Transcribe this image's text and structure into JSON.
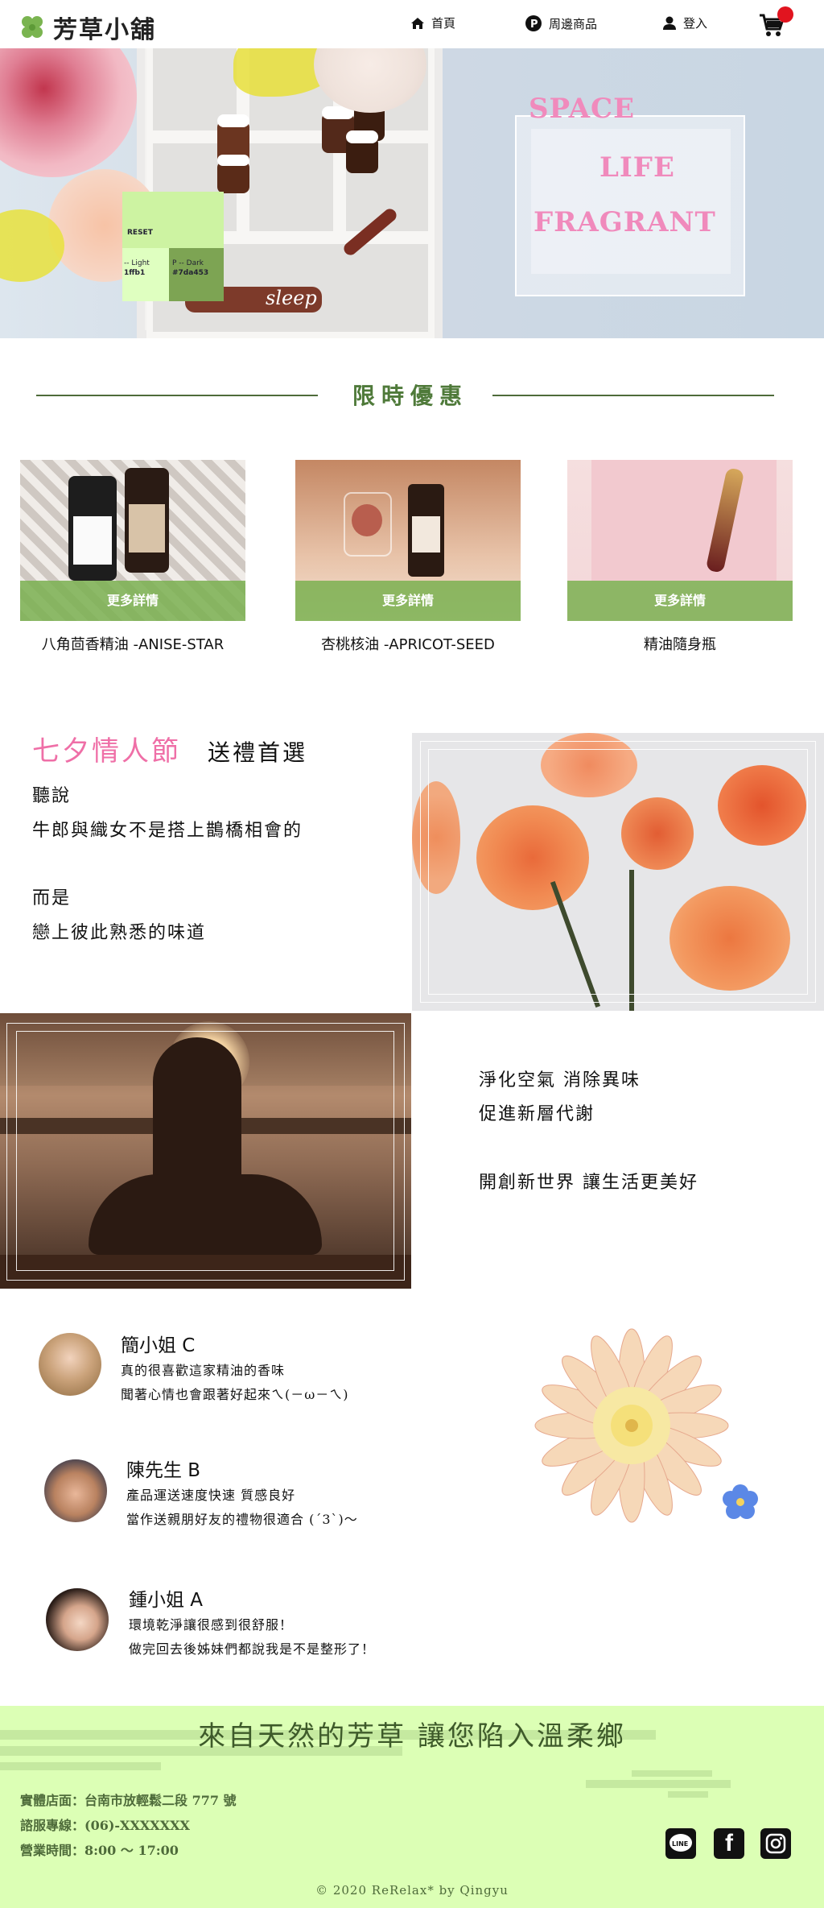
{
  "header": {
    "logo_text": "芳草小舖",
    "nav": [
      {
        "label": "首頁",
        "icon": "home-icon"
      },
      {
        "label": "周邊商品",
        "icon": "p-badge-icon"
      },
      {
        "label": "登入",
        "icon": "user-icon"
      }
    ],
    "cart_icon": "cart-icon"
  },
  "hero": {
    "words": [
      "SPACE",
      "LIFE",
      "FRAGRANT"
    ],
    "swatch": {
      "reset": "RESET",
      "light_label": "-- Light",
      "light_value": "1ffb1",
      "dark_label": "P -- Dark",
      "dark_value": "#7da453"
    },
    "script_word": "sleep"
  },
  "promo": {
    "title": "限時優惠",
    "items": [
      {
        "name": "八角茴香精油 -ANISE-STAR",
        "more": "更多詳情"
      },
      {
        "name": "杏桃核油 -APRICOT-SEED",
        "more": "更多詳情"
      },
      {
        "name": "精油隨身瓶",
        "more": "更多詳情"
      }
    ]
  },
  "qixi": {
    "title": "七夕情人節",
    "subtitle": "送禮首選",
    "lines": [
      "聽說",
      "牛郎與織女不是搭上鵲橋相會的",
      "而是",
      "戀上彼此熟悉的味道"
    ]
  },
  "purify": {
    "lines": [
      "淨化空氣  消除異味",
      "促進新層代謝",
      "開創新世界  讓生活更美好"
    ]
  },
  "reviews": [
    {
      "name": "簡小姐 C",
      "lines": [
        "真的很喜歡這家精油的香味",
        "聞著心情也會跟著好起來ㄟ(－ω－ㄟ)"
      ]
    },
    {
      "name": "陳先生 B",
      "lines": [
        "產品運送速度快速  質感良好",
        "當作送親朋好友的禮物很適合 (´3`)～"
      ]
    },
    {
      "name": "鍾小姐 A",
      "lines": [
        "環境乾淨讓很感到很舒服！",
        "做完回去後姊妹們都說我是不是整形了！"
      ]
    }
  ],
  "footer": {
    "slogan": "來自天然的芳草  讓您陷入溫柔鄉",
    "store": "實體店面：台南市放輕鬆二段 777 號",
    "phone": "諮服專線：(06)-XXXXXXX",
    "hours": "營業時間：8:00 ～ 17:00",
    "social": [
      {
        "label": "LINE",
        "icon": "line-icon"
      },
      {
        "label": "f",
        "icon": "facebook-icon"
      },
      {
        "label": "",
        "icon": "instagram-icon"
      }
    ],
    "copyright": "© 2020 ReRelax* by Qingyu"
  },
  "colors": {
    "accent_green": "#7da453",
    "light_green": "#dcffb5",
    "pink": "#ef6fa7",
    "cart_badge": "#e1141f"
  }
}
